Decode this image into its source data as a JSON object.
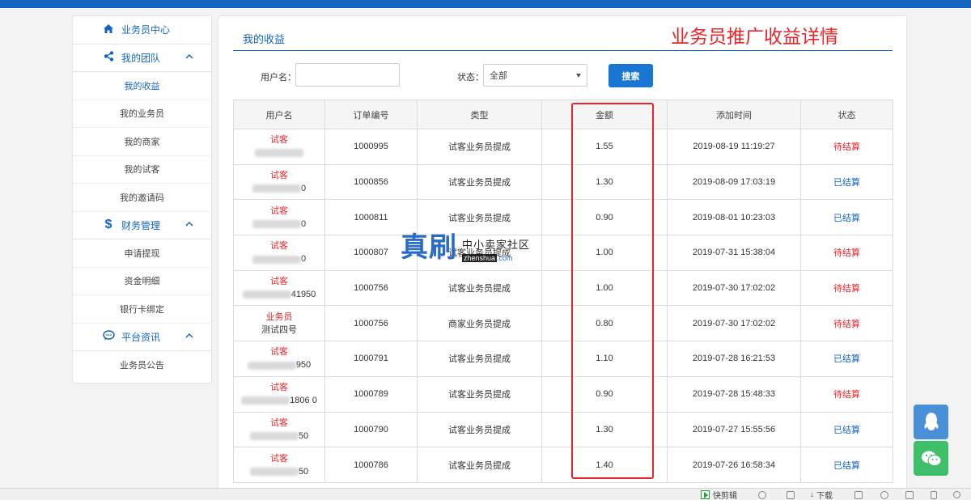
{
  "sidebar": {
    "header": "业务员中心",
    "groups": [
      {
        "title": "我的团队",
        "icon": "share-icon",
        "items": [
          "我的收益",
          "我的业务员",
          "我的商家",
          "我的试客",
          "我的邀请码"
        ]
      },
      {
        "title": "财务管理",
        "icon": "dollar-icon",
        "items": [
          "申请提现",
          "资金明细",
          "银行卡绑定"
        ]
      },
      {
        "title": "平台资讯",
        "icon": "chat-icon",
        "items": [
          "业务员公告"
        ]
      }
    ]
  },
  "main": {
    "title": "我的收益",
    "promo_heading": "业务员推广收益详情",
    "filter": {
      "username_label": "用户名：",
      "username_value": "",
      "status_label": "状态：",
      "status_value": "全部",
      "search_button": "搜索"
    },
    "table": {
      "columns": [
        "用户名",
        "订单编号",
        "类型",
        "金额",
        "添加时间",
        "状态"
      ],
      "rows": [
        {
          "user_type": "试客",
          "user_suffix": "",
          "order_no": "1000995",
          "type": "试客业务员提成",
          "amount": "1.55",
          "time": "2019-08-19 11:19:27",
          "status": "待结算",
          "status_kind": "pending"
        },
        {
          "user_type": "试客",
          "user_suffix": "0",
          "order_no": "1000856",
          "type": "试客业务员提成",
          "amount": "1.30",
          "time": "2019-08-09 17:03:19",
          "status": "已结算",
          "status_kind": "done"
        },
        {
          "user_type": "试客",
          "user_suffix": "0",
          "order_no": "1000811",
          "type": "试客业务员提成",
          "amount": "0.90",
          "time": "2019-08-01 10:23:03",
          "status": "已结算",
          "status_kind": "done"
        },
        {
          "user_type": "试客",
          "user_suffix": "0",
          "order_no": "1000807",
          "type": "试客业务员提成",
          "amount": "1.00",
          "time": "2019-07-31 15:38:04",
          "status": "待结算",
          "status_kind": "pending"
        },
        {
          "user_type": "试客",
          "user_suffix": "41950",
          "order_no": "1000756",
          "type": "试客业务员提成",
          "amount": "1.00",
          "time": "2019-07-30 17:02:02",
          "status": "待结算",
          "status_kind": "pending"
        },
        {
          "user_type": "业务员",
          "user_suffix": "测试四号",
          "order_no": "1000756",
          "type": "商家业务员提成",
          "amount": "0.80",
          "time": "2019-07-30 17:02:02",
          "status": "待结算",
          "status_kind": "pending"
        },
        {
          "user_type": "试客",
          "user_suffix": "950",
          "order_no": "1000791",
          "type": "试客业务员提成",
          "amount": "1.10",
          "time": "2019-07-28 16:21:53",
          "status": "已结算",
          "status_kind": "done"
        },
        {
          "user_type": "试客",
          "user_suffix": "1806 0",
          "order_no": "1000789",
          "type": "试客业务员提成",
          "amount": "0.90",
          "time": "2019-07-28 15:48:33",
          "status": "待结算",
          "status_kind": "pending"
        },
        {
          "user_type": "试客",
          "user_suffix": "50",
          "order_no": "1000790",
          "type": "试客业务员提成",
          "amount": "1.30",
          "time": "2019-07-27 15:55:56",
          "status": "已结算",
          "status_kind": "done"
        },
        {
          "user_type": "试客",
          "user_suffix": "50",
          "order_no": "1000786",
          "type": "试客业务员提成",
          "amount": "1.40",
          "time": "2019-07-26 16:58:34",
          "status": "已结算",
          "status_kind": "done"
        }
      ]
    }
  },
  "watermark": {
    "big": "真刷",
    "cn": "中小卖家社区",
    "en": "zhenshua",
    "tld": ".com"
  },
  "statusbar": {
    "clip": "快剪辑",
    "download": "下载"
  },
  "colors": {
    "accent": "#1565c0",
    "danger": "#e8252a",
    "qq": "#4a90d9",
    "wechat": "#3fbf6a"
  }
}
